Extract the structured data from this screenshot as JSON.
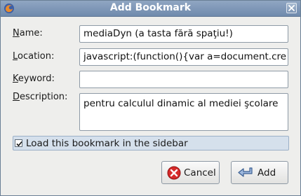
{
  "window": {
    "title": "Add Bookmark",
    "app_icon": "firefox-icon",
    "close_icon": "close-icon"
  },
  "form": {
    "name": {
      "label_key": "N",
      "label_rest": "ame:",
      "value": "mediaDyn (a tasta fără spaţiu!)"
    },
    "location": {
      "label_key": "L",
      "label_rest": "ocation:",
      "value": "javascript:(function(){var a=document.cre"
    },
    "keyword": {
      "label_key": "K",
      "label_rest": "eyword:",
      "value": ""
    },
    "description": {
      "label_key": "D",
      "label_rest": "escription:",
      "value": "pentru calculul dinamic al mediei şcolare"
    }
  },
  "sidebar_option": {
    "label_key": "L",
    "label_rest": "oad this bookmark in the sidebar",
    "checked": true
  },
  "buttons": {
    "cancel": {
      "label": "Cancel",
      "icon": "cancel-icon"
    },
    "add": {
      "label": "Add",
      "icon": "add-arrow-icon"
    }
  }
}
